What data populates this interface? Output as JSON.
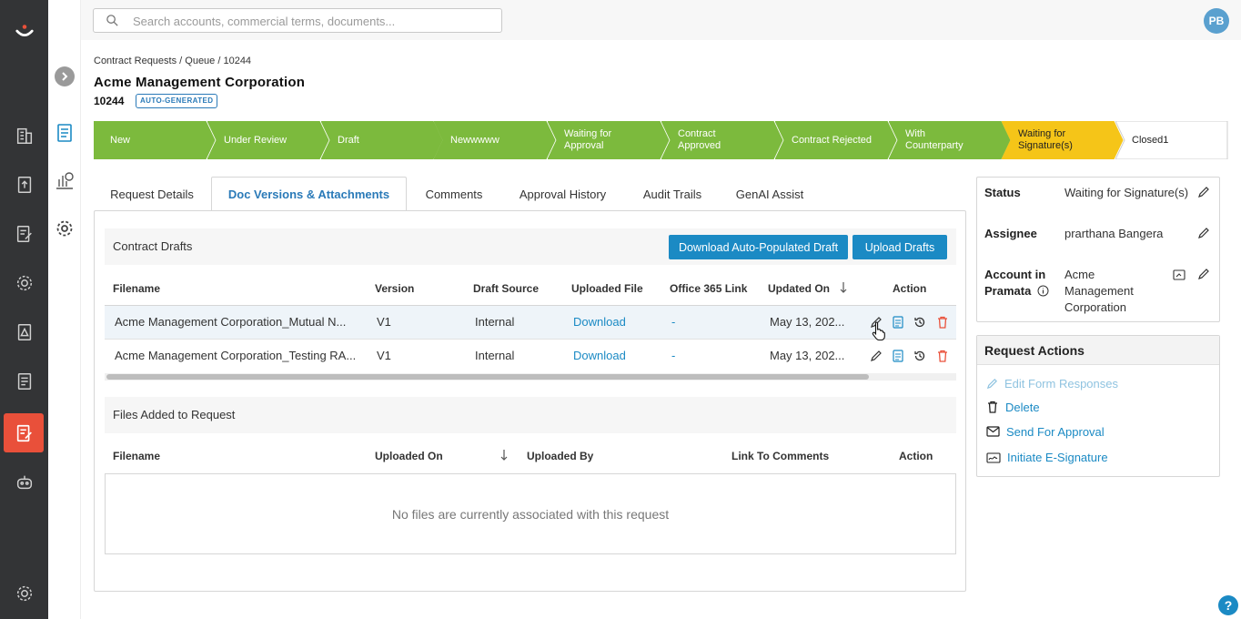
{
  "search": {
    "placeholder": "Search accounts, commercial terms, documents..."
  },
  "user": {
    "initials": "PB"
  },
  "breadcrumb": "Contract Requests / Queue / 10244",
  "page": {
    "title": "Acme Management Corporation",
    "request_id": "10244",
    "badge": "AUTO-GENERATED"
  },
  "stages": [
    {
      "label": "New",
      "state": "done"
    },
    {
      "label": "Under Review",
      "state": "done"
    },
    {
      "label": "Draft",
      "state": "done"
    },
    {
      "label": "Newwwww",
      "state": "done"
    },
    {
      "label": "Waiting for Approval",
      "state": "done"
    },
    {
      "label": "Contract Approved",
      "state": "done"
    },
    {
      "label": "Contract Rejected",
      "state": "done"
    },
    {
      "label": "With Counterparty",
      "state": "done"
    },
    {
      "label": "Waiting for Signature(s)",
      "state": "current"
    },
    {
      "label": "Closed1",
      "state": "pending"
    }
  ],
  "stage_lines": [
    [
      "New"
    ],
    [
      "Under Review"
    ],
    [
      "Draft"
    ],
    [
      "Newwwww"
    ],
    [
      "Waiting for",
      "Approval"
    ],
    [
      "Contract",
      "Approved"
    ],
    [
      "Contract Rejected"
    ],
    [
      "With",
      "Counterparty"
    ],
    [
      "Waiting for",
      "Signature(s)"
    ],
    [
      "Closed1"
    ]
  ],
  "colors": {
    "done": "#7cba3d",
    "current": "#f5c518",
    "accent": "#1b8ac4",
    "danger": "#e9503a"
  },
  "tabs": [
    "Request Details",
    "Doc Versions & Attachments",
    "Comments",
    "Approval History",
    "Audit Trails",
    "GenAI Assist"
  ],
  "active_tab": "Doc Versions & Attachments",
  "contract_drafts": {
    "title": "Contract Drafts",
    "download_button": "Download Auto-Populated Draft",
    "upload_button": "Upload Drafts",
    "columns": [
      "Filename",
      "Version",
      "Draft Source",
      "Uploaded File",
      "Office 365 Link",
      "Updated On",
      "Action"
    ],
    "rows": [
      {
        "filename": "Acme Management Corporation_Mutual N...",
        "version": "V1",
        "source": "Internal",
        "file": "Download",
        "o365": "-",
        "updated": "May 13, 202..."
      },
      {
        "filename": "Acme Management Corporation_Testing RA...",
        "version": "V1",
        "source": "Internal",
        "file": "Download",
        "o365": "-",
        "updated": "May 13, 202..."
      }
    ]
  },
  "files_added": {
    "title": "Files Added to Request",
    "columns": [
      "Filename",
      "Uploaded On",
      "Uploaded By",
      "Link To Comments",
      "Action"
    ],
    "empty": "No files are currently associated with this request"
  },
  "info": {
    "status_label": "Status",
    "status_value": "Waiting for Signature(s)",
    "assignee_label": "Assignee",
    "assignee_value": "prarthana Bangera",
    "account_label_1": "Account in",
    "account_label_2": "Pramata",
    "account_value_1": "Acme",
    "account_value_2": "Management",
    "account_value_3": "Corporation"
  },
  "request_actions": {
    "title": "Request Actions",
    "items": [
      "Edit Form Responses",
      "Delete",
      "Send For Approval",
      "Initiate E-Signature"
    ]
  },
  "help": "?"
}
